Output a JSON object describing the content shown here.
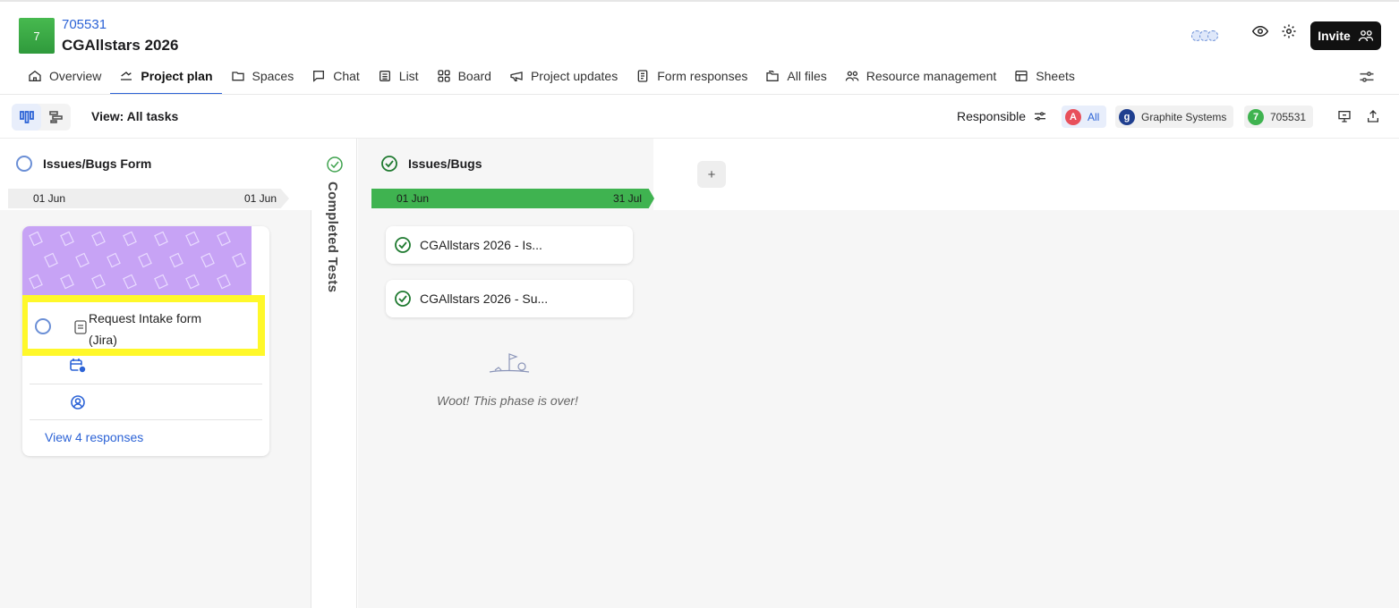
{
  "project": {
    "badge": "7",
    "id": "705531",
    "name": "CGAllstars 2026"
  },
  "header": {
    "invite_label": "Invite"
  },
  "tabs": [
    {
      "label": "Overview",
      "icon": "home-icon"
    },
    {
      "label": "Project plan",
      "icon": "plan-icon",
      "active": true
    },
    {
      "label": "Spaces",
      "icon": "folder-icon"
    },
    {
      "label": "Chat",
      "icon": "chat-icon"
    },
    {
      "label": "List",
      "icon": "list-icon"
    },
    {
      "label": "Board",
      "icon": "board-icon"
    },
    {
      "label": "Project updates",
      "icon": "megaphone-icon"
    },
    {
      "label": "Form responses",
      "icon": "form-icon"
    },
    {
      "label": "All files",
      "icon": "files-icon"
    },
    {
      "label": "Resource management",
      "icon": "people-icon"
    },
    {
      "label": "Sheets",
      "icon": "table-icon"
    }
  ],
  "toolbar": {
    "view_label": "View: All tasks",
    "responsible_label": "Responsible",
    "chips": [
      {
        "badge": "A",
        "label": "All",
        "color": "#e8505b"
      },
      {
        "badge": "g",
        "label": "Graphite Systems",
        "color": "#1f3f8f"
      },
      {
        "badge": "7",
        "label": "705531",
        "color": "#3fb350"
      }
    ]
  },
  "phases": [
    {
      "title": "Issues/Bugs Form",
      "start": "01 Jun",
      "end": "01 Jun",
      "card": {
        "title": "Request Intake form (Jira)",
        "link": "View 4 responses"
      }
    },
    {
      "title": "Completed Tests"
    },
    {
      "title": "Issues/Bugs",
      "start": "01 Jun",
      "end": "31 Jul",
      "tasks": [
        "CGAllstars 2026 - Is...",
        "CGAllstars 2026 - Su..."
      ],
      "empty_message": "Woot! This phase is over!"
    }
  ],
  "colors": {
    "accent": "#2c63d6",
    "green": "#3fb350",
    "highlight": "#fff82a",
    "cover": "#c7a3f5"
  }
}
